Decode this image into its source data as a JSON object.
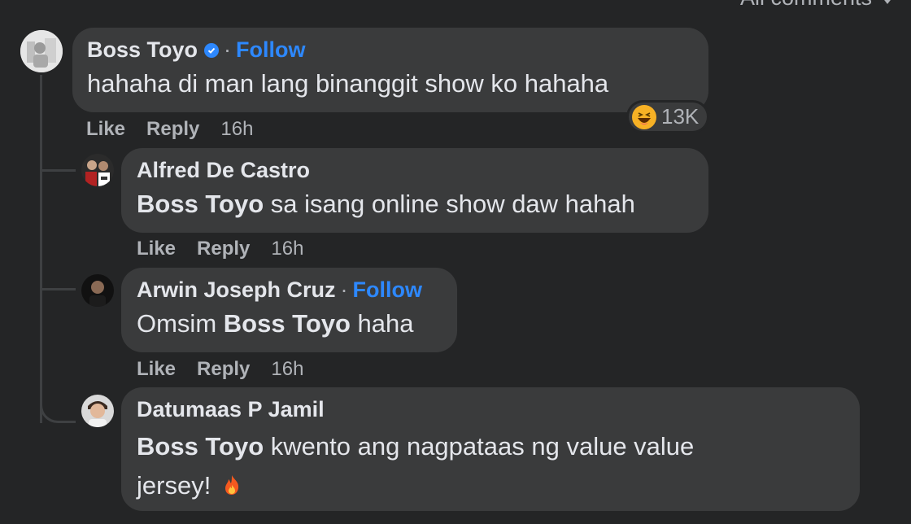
{
  "header": {
    "sort_label": "All comments"
  },
  "comments": [
    {
      "author": "Boss Toyo",
      "follow": "Follow",
      "separator": "·",
      "text": "hahaha di man lang binanggit show ko hahaha",
      "reaction_count": "13K",
      "actions": {
        "like": "Like",
        "reply": "Reply",
        "time": "16h"
      }
    },
    {
      "author": "Alfred De Castro",
      "mention": "Boss Toyo",
      "text": " sa isang online show daw hahah",
      "actions": {
        "like": "Like",
        "reply": "Reply",
        "time": "16h"
      }
    },
    {
      "author": "Arwin Joseph Cruz",
      "follow": "Follow",
      "separator": "·",
      "text_before": "Omsim ",
      "mention": "Boss Toyo",
      "text_after": " haha",
      "actions": {
        "like": "Like",
        "reply": "Reply",
        "time": "16h"
      }
    },
    {
      "author": "Datumaas P Jamil",
      "mention": "Boss Toyo",
      "text_line1": " kwento ang nagpataas ng value value",
      "text_line2": "jersey!"
    }
  ],
  "colors": {
    "background": "#242526",
    "bubble": "#3a3b3c",
    "link": "#2d88ff",
    "muted": "#b0b3b8"
  },
  "icons": [
    "verified-badge-icon",
    "haha-reaction-icon",
    "fire-emoji-icon",
    "chevron-down-icon"
  ]
}
